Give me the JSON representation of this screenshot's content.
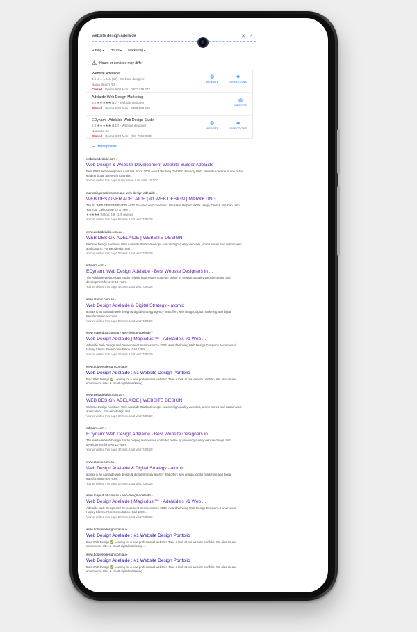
{
  "search": {
    "query": "website design adelaide"
  },
  "filters": [
    "Rating",
    "Hours",
    "Marketing"
  ],
  "hours_notice": "Hours or services may differ",
  "local_pack": [
    {
      "name": "Website Adelaide",
      "rating_line": "4.9 ★★★★★ (39) · Website designer",
      "line2": "Nadia Beach Rd",
      "status": "Closed",
      "hours": "· Opens 9:00 Mon · 0401 779 237",
      "actions": [
        "WEBSITE",
        "DIRECTIONS"
      ]
    },
    {
      "name": "Adelaide Web Design Marketing",
      "rating_line": "5.0 ★★★★★ (11) · Website designer",
      "line2": "",
      "status": "Closed",
      "hours": "· Opens 9:00 Mon · 0450 553 555",
      "actions": [
        "WEBSITE"
      ]
    },
    {
      "name": "EDynam - Adelaide Web Design Studio",
      "rating_line": "5.0 ★★★★★ (142) · Website designer",
      "line2": "Norwood SA",
      "status": "Closed",
      "hours": "· Opens 9:00 Mon · (08) 7002 9838",
      "actions": [
        "WEBSITE",
        "DIRECTIONS"
      ]
    }
  ],
  "more_places": "More places",
  "results": [
    {
      "cite": "websiteadelaide.com",
      "title": "Web Design & Website Development Website Builder Adelaide",
      "snippet": "Best Website Development Australia Since 2004 Award Winning Get SEO Friendly Web. WebsiteAdelaide is one of the leading digital agency in Australia.",
      "visited": "You've visited this page many times. Last visit: 2/07/20"
    },
    {
      "cite": "marketingcreatives.com.au › web-design-adelaide",
      "title": "WEB DESIGNER ADELAIDE | #1 WEB DESIGN | MARKETING ...",
      "snippet": "The #1 WEB DESIGNER ADELAIDE Focused on Conversion. We Have Helped 1000+ Happy Clients. We Can Help You Too. Call us now for a Free ...",
      "rating": "★★★★★ Rating: 4.9 · 128 reviews",
      "visited": "You've visited this page 5 times. Last visit: 7/07/20"
    },
    {
      "cite": "www.webadelaide.com.au",
      "title": "WEB DESIGN ADELAIDE | WEBSITE DESIGN",
      "snippet": "Website Design Adelaide. Web Adelaide Studio develops custom high-quality websites, online stores and custom web applications. For web design and ...",
      "visited": "You've visited this page 2 times. Last visit: 7/07/20"
    },
    {
      "cite": "edynam.com",
      "title": "EDynam: Web Design Adelaide - Best Website Designers in ...",
      "snippet": "The Adelaide Web Design Studio helping businesses do better online by providing quality website design and development for over 10 years.",
      "visited": "You've visited this page 4 times. Last visit: 7/07/20"
    },
    {
      "cite": "www.atomix.com.au",
      "title": "Web Design Adelaide & Digital Strategy - atomix",
      "snippet": "atomix is an Adelaide web design & digital strategy agency that offers web design, digital marketing and digital transformation services.",
      "visited": "You've visited this page 2 times. Last visit: 7/07/20"
    },
    {
      "cite": "www.magicdust.com.au › web-design-adelaide",
      "title": "Web Design Adelaide | Magicdust™ - Adelaide's #1 Web ...",
      "snippet": "Adelaide Web Design and Development Services since 2004. Award Winning Web Design Company. Hundreds of Happy Clients. Free Consultation. Call 1300 ...",
      "visited": "You've visited this page 2 times. Last visit: 7/07/20"
    },
    {
      "cite": "www.boldwebdesign.com.au",
      "title": "Web Design Adelaide : #1 Website Design Portfolio",
      "snippet": "Bold Web Design ✅ Looking for a new professional website? Take a look at our website portfolio. We also create ecommerce sites & smart digital marketing ...",
      "visited": ""
    },
    {
      "cite": "www.webadelaide.com.au",
      "title": "WEB DESIGN ADELAIDE | WEBSITE DESIGN",
      "snippet": "Website Design Adelaide. Web Adelaide Studio develops custom high-quality websites, online stores and custom web applications. For web design and ...",
      "visited": "You've visited this page 2 times. Last visit: 7/07/20"
    },
    {
      "cite": "edynam.com",
      "title": "EDynam: Web Design Adelaide - Best Website Designers in ...",
      "snippet": "The Adelaide Web Design Studio helping businesses do better online by providing quality website design and development for over 10 years.",
      "visited": "You've visited this page 4 times. Last visit: 7/07/20"
    },
    {
      "cite": "www.atomix.com.au",
      "title": "Web Design Adelaide & Digital Strategy - atomix",
      "snippet": "atomix is an Adelaide web design & digital strategy agency that offers web design, digital marketing and digital transformation services.",
      "visited": "You've visited this page 2 times. Last visit: 7/07/20"
    },
    {
      "cite": "www.magicdust.com.au › web-design-adelaide",
      "title": "Web Design Adelaide | Magicdust™ - Adelaide's #1 Web ...",
      "snippet": "Adelaide Web Design and Development Services since 2004. Award Winning Web Design Company. Hundreds of Happy Clients. Free Consultation. Call 1300 ...",
      "visited": "You've visited this page 2 times. Last visit: 7/07/20"
    },
    {
      "cite": "www.boldwebdesign.com.au",
      "title": "Web Design Adelaide : #1 Website Design Portfolio",
      "snippet": "Bold Web Design ✅ Looking for a new professional website? Take a look at our website portfolio. We also create ecommerce sites & smart digital marketing ...",
      "visited": ""
    },
    {
      "cite": "www.boldwebdesign.com.au",
      "title": "Web Design Adelaide : #1 Website Design Portfolio",
      "snippet": "Bold Web Design ✅ Looking for a new professional website? Take a look at our website portfolio. We also create ecommerce sites & smart digital marketing ...",
      "visited": ""
    }
  ],
  "colors": {
    "link_visited": "#5b1fa8",
    "link": "#1a0dab",
    "closed": "#d93025",
    "accent": "#1a73e8",
    "star": "#fbbc04"
  }
}
